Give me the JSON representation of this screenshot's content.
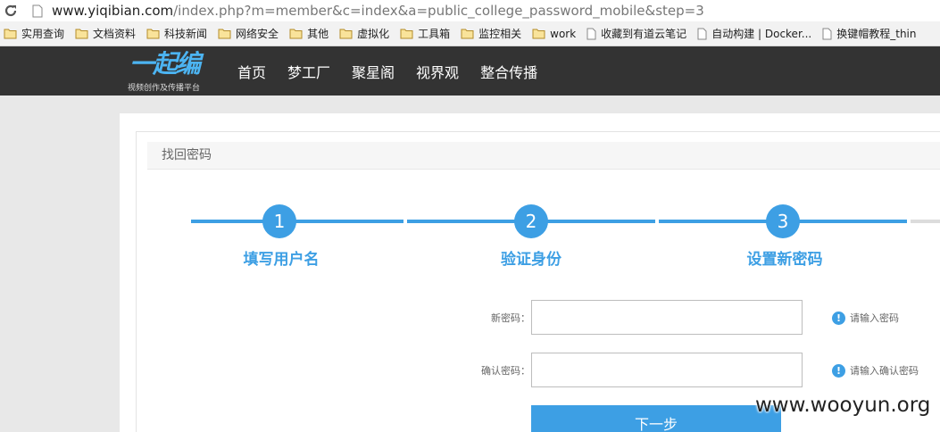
{
  "browser": {
    "url_host": "www.yiqibian.com",
    "url_path": "/index.php?m=member&c=index&a=public_college_password_mobile&step=3"
  },
  "bookmarks": [
    {
      "label": "实用查询",
      "icon": "folder-icon"
    },
    {
      "label": "文档资料",
      "icon": "folder-icon"
    },
    {
      "label": "科技新闻",
      "icon": "folder-icon"
    },
    {
      "label": "网络安全",
      "icon": "folder-icon"
    },
    {
      "label": "其他",
      "icon": "folder-icon"
    },
    {
      "label": "虚拟化",
      "icon": "folder-icon"
    },
    {
      "label": "工具箱",
      "icon": "folder-icon"
    },
    {
      "label": "监控相关",
      "icon": "folder-icon"
    },
    {
      "label": "work",
      "icon": "folder-icon"
    },
    {
      "label": "收藏到有道云笔记",
      "icon": "page-icon"
    },
    {
      "label": "自动构建 | Docker...",
      "icon": "page-icon"
    },
    {
      "label": "换键帽教程_thin",
      "icon": "page-icon"
    }
  ],
  "site": {
    "logo_text": "一起编",
    "logo_subtitle": "视频创作及传播平台",
    "nav": [
      "首页",
      "梦工厂",
      "聚星阁",
      "视界观",
      "整合传播"
    ]
  },
  "panel": {
    "title": "找回密码"
  },
  "steps": [
    {
      "number": "1",
      "label": "填写用户名"
    },
    {
      "number": "2",
      "label": "验证身份"
    },
    {
      "number": "3",
      "label": "设置新密码"
    }
  ],
  "form": {
    "new_password_label": "新密码：",
    "new_password_value": "",
    "new_password_hint": "请输入密码",
    "confirm_password_label": "确认密码：",
    "confirm_password_value": "",
    "confirm_password_hint": "请输入确认密码",
    "next_button": "下一步"
  },
  "watermark": "www.wooyun.org",
  "colors": {
    "accent": "#3d9fe4",
    "header_bg": "#333333"
  }
}
